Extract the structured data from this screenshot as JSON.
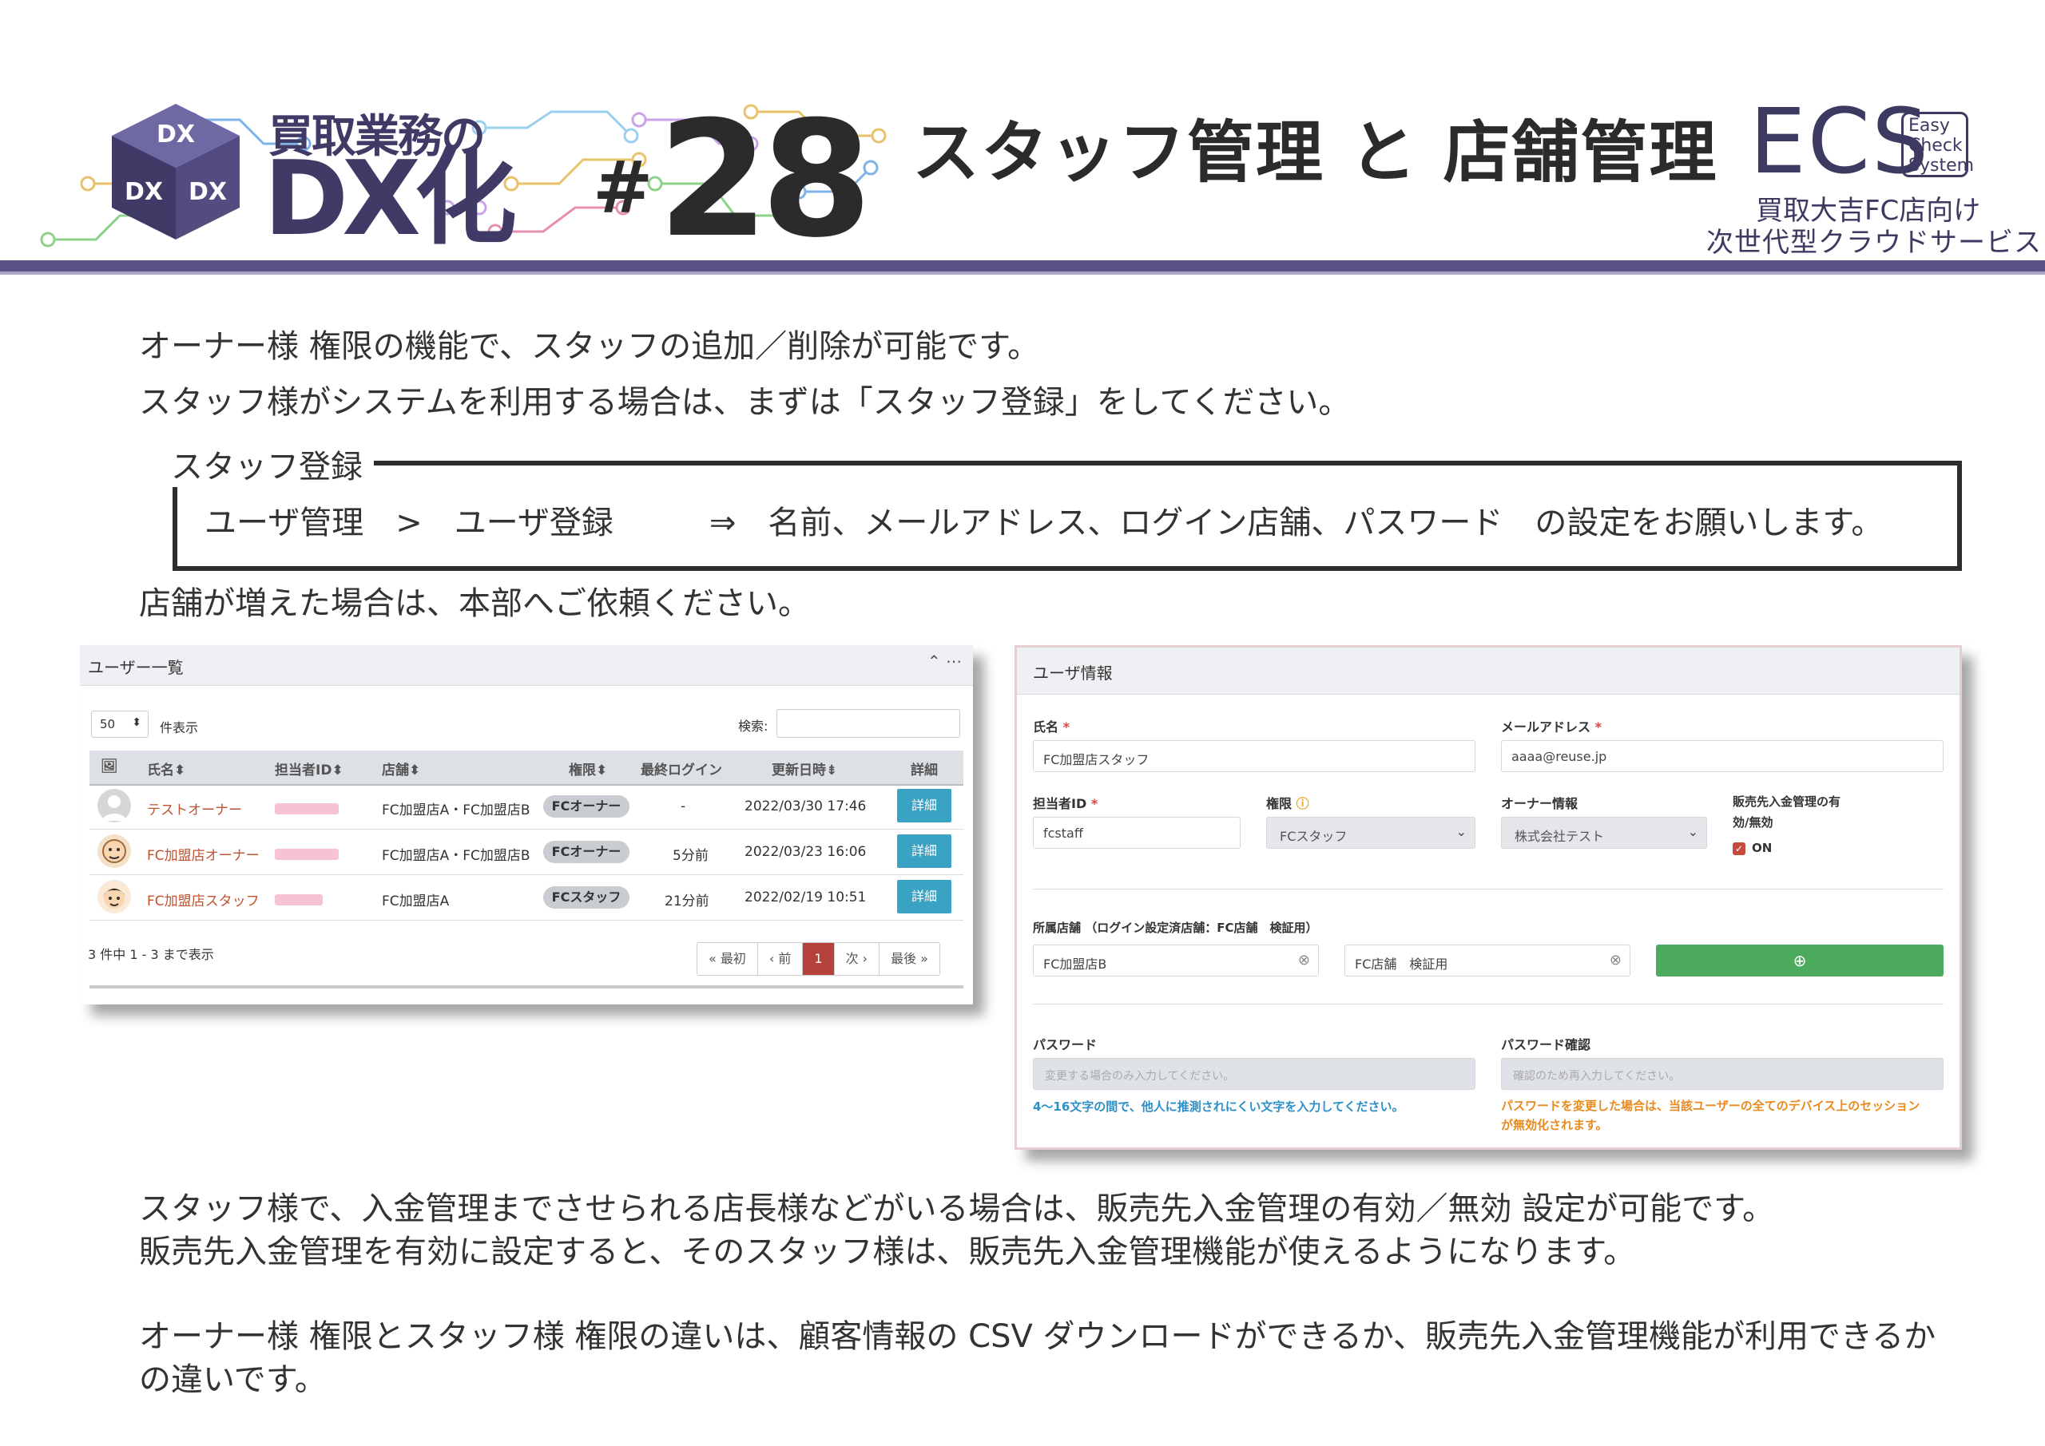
{
  "header": {
    "series_small": "買取業務の",
    "series_big": "DX化",
    "cube_label": "DX",
    "issue_hash": "#",
    "issue_number": "28",
    "title": "スタッフ管理 と 店舗管理",
    "logo": "ECS",
    "logo_badge": [
      "Easy",
      "Check",
      "System"
    ],
    "tagline1": "買取大吉FC店向け",
    "tagline2": "次世代型クラウドサービス",
    "accent_color": "#5a5486"
  },
  "intro": {
    "line1": "オーナー様 権限の機能で、スタッフの追加／削除が可能です。",
    "line2": "スタッフ様がシステムを利用する場合は、まずは「スタッフ登録」をしてください。"
  },
  "box": {
    "label": "スタッフ登録",
    "text": "ユーザ管理　>　ユーザ登録　　　⇒　名前、メールアドレス、ログイン店舗、パスワード　の設定をお願いします。"
  },
  "store_note": "店舗が増えた場合は、本部へご依頼ください。",
  "user_list": {
    "title": "ユーザー一覧",
    "controls": "⌃ ⋯",
    "per_page_value": "50",
    "per_page_suffix": "件表示",
    "search_label": "検索:",
    "columns": [
      "氏名",
      "担当者ID",
      "店舗",
      "権限",
      "最終ログイン",
      "更新日時",
      "詳細"
    ],
    "rows": [
      {
        "name": "テストオーナー",
        "store": "FC加盟店A・FC加盟店B",
        "role": "FCオーナー",
        "last_login": "-",
        "updated": "2022/03/30 17:46",
        "detail": "詳細"
      },
      {
        "name": "FC加盟店オーナー",
        "store": "FC加盟店A・FC加盟店B",
        "role": "FCオーナー",
        "last_login": "5分前",
        "updated": "2022/03/23 16:06",
        "detail": "詳細"
      },
      {
        "name": "FC加盟店スタッフ",
        "store": "FC加盟店A",
        "role": "FCスタッフ",
        "last_login": "21分前",
        "updated": "2022/02/19 10:51",
        "detail": "詳細"
      }
    ],
    "summary": "3 件中 1 - 3 まで表示",
    "pager": [
      "« 最初",
      "‹ 前",
      "1",
      "次 ›",
      "最後 »"
    ]
  },
  "user_info": {
    "title": "ユーザ情報",
    "name_label": "氏名",
    "name_value": "FC加盟店スタッフ",
    "email_label": "メールアドレス",
    "email_value": "aaaa@reuse.jp",
    "staff_id_label": "担当者ID",
    "staff_id_value": "fcstaff",
    "role_label": "権限",
    "role_value": "FCスタッフ",
    "owner_label": "オーナー情報",
    "owner_value": "株式会社テスト",
    "payment_label1": "販売先入金管理の有",
    "payment_label2": "効/無効",
    "payment_value": "ON",
    "store_label": "所属店舗 （ログイン設定済店舗：FC店舗　検証用）",
    "store1": "FC加盟店B",
    "store2": "FC店舗　検証用",
    "add_icon": "⊕",
    "password_label": "パスワード",
    "password_placeholder": "変更する場合のみ入力してください。",
    "password_hint": "4〜16文字の間で、他人に推測されにくい文字を入力してください。",
    "confirm_label": "パスワード確認",
    "confirm_placeholder": "確認のため再入力してください。",
    "confirm_hint1": "パスワードを変更した場合は、当該ユーザーの全てのデバイス上のセッション",
    "confirm_hint2": "が無効化されます。"
  },
  "notes": {
    "line1": "スタッフ様で、入金管理までさせられる店長様などがいる場合は、販売先入金管理の有効／無効 設定が可能です。",
    "line2": "販売先入金管理を有効に設定すると、そのスタッフ様は、販売先入金管理機能が使えるようになります。",
    "line3": "オーナー様 権限とスタッフ様 権限の違いは、顧客情報の CSV ダウンロードができるか、販売先入金管理機能が利用できるか",
    "line4": "の違いです。"
  }
}
